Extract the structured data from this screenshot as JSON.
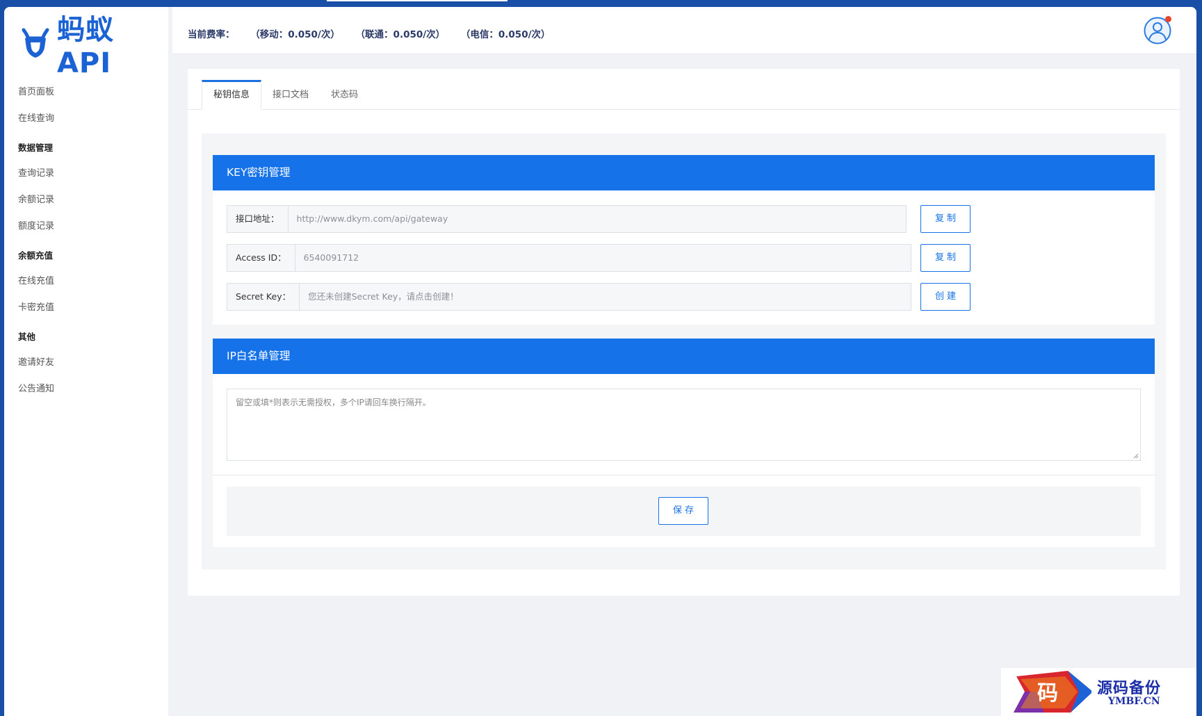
{
  "logo": {
    "text": "蚂蚁API"
  },
  "sidebar": {
    "items": [
      {
        "type": "item",
        "label": "首页面板"
      },
      {
        "type": "item",
        "label": "在线查询"
      },
      {
        "type": "group",
        "label": "数据管理"
      },
      {
        "type": "item",
        "label": "查询记录"
      },
      {
        "type": "item",
        "label": "余额记录"
      },
      {
        "type": "item",
        "label": "额度记录"
      },
      {
        "type": "group",
        "label": "余额充值"
      },
      {
        "type": "item",
        "label": "在线充值"
      },
      {
        "type": "item",
        "label": "卡密充值"
      },
      {
        "type": "group",
        "label": "其他"
      },
      {
        "type": "item",
        "label": "邀请好友"
      },
      {
        "type": "item",
        "label": "公告通知"
      }
    ]
  },
  "header": {
    "rate_label": "当前费率：",
    "rate_mobile": "（移动：0.050/次）",
    "rate_unicom": "（联通：0.050/次）",
    "rate_telecom": "（电信：0.050/次）"
  },
  "tabs": [
    "秘钥信息",
    "接口文档",
    "状态码"
  ],
  "key_panel": {
    "title": "KEY密钥管理",
    "endpoint_label": "接口地址：",
    "endpoint_value": "http://www.dkym.com/api/gateway",
    "access_id_label": "Access ID：",
    "access_id_value": "6540091712",
    "secret_key_label": "Secret Key：",
    "secret_key_value": "您还未创建Secret Key，请点击创建！",
    "copy_label": "复制",
    "create_label": "创建"
  },
  "ip_panel": {
    "title": "IP白名单管理",
    "placeholder": "留空或填*则表示无需授权，多个IP请回车换行隔开。",
    "save_label": "保存"
  },
  "watermark": {
    "title": "源码备份",
    "sub": "YMBF.CN",
    "glyph": "码"
  },
  "colors": {
    "primary": "#1672e8",
    "brand": "#1b62d4",
    "frame": "#1a4fa8",
    "badge": "#e8452e"
  }
}
